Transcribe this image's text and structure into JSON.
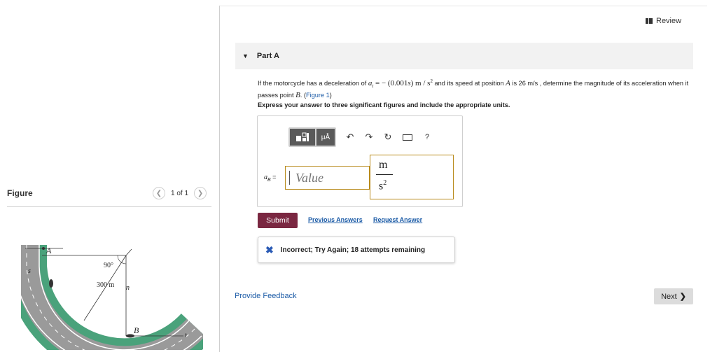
{
  "figure_panel": {
    "title": "Figure",
    "pager_text": "1 of 1",
    "labels": {
      "A": "A",
      "B": "B",
      "s": "s",
      "n": "n",
      "t": "t",
      "angle": "90°",
      "radius": "300 m"
    }
  },
  "header": {
    "review_label": "Review"
  },
  "part": {
    "title": "Part A"
  },
  "problem": {
    "text1": "If the motorcycle has a deceleration of ",
    "at_math": "a",
    "at_sub": "t",
    "eq_text": " = − (0.001",
    "s_var": "s",
    "units_text": ") m / s",
    "units_sup": "2",
    "text2": " and its speed at position ",
    "A": "A",
    "text3": " is 26 m/s , determine the magnitude of its acceleration when it passes point ",
    "B": "B",
    "text4": ". (",
    "figure_link": "Figure 1",
    "text5": ")"
  },
  "instruction": "Express your answer to three significant figures and include the appropriate units.",
  "answer": {
    "label_var": "a",
    "label_sub": "B",
    "label_eq": " =",
    "value_placeholder": "Value",
    "value": "",
    "unit_numerator": "m",
    "unit_denominator": "s",
    "unit_den_sup": "2"
  },
  "toolbar": {
    "units_symbol": "μÅ",
    "help_symbol": "?"
  },
  "actions": {
    "submit_label": "Submit",
    "previous_answers": "Previous Answers",
    "request_answer": "Request Answer"
  },
  "feedback": {
    "message": "Incorrect; Try Again; 18 attempts remaining"
  },
  "footer": {
    "provide_feedback": "Provide Feedback",
    "next_label": "Next"
  },
  "colors": {
    "submit_bg": "#7a2741",
    "link": "#1a5aa6",
    "input_border": "#b88a1a",
    "road_border": "#4aa27b",
    "road_surface": "#9a9a9a"
  }
}
